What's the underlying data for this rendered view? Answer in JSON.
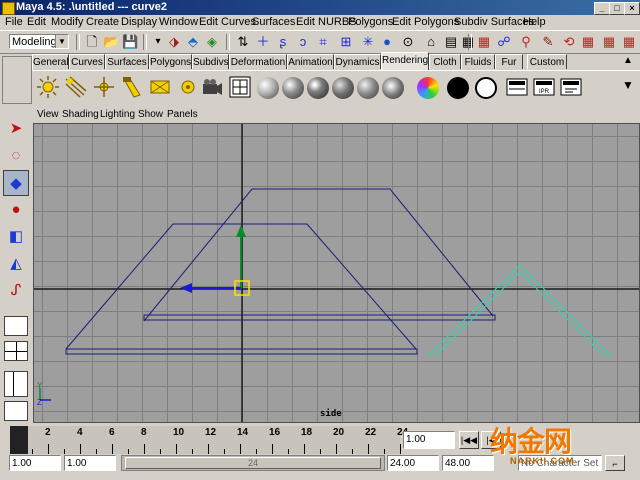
{
  "window": {
    "title": "Maya 4.5: .\\untitled  ---  curve2"
  },
  "menu": [
    "File",
    "Edit",
    "Modify",
    "Create",
    "Display",
    "Window",
    "Edit Curves",
    "Surfaces",
    "Edit NURBS",
    "Polygons",
    "Edit Polygons",
    "Subdiv Surfaces",
    "Help"
  ],
  "statusline": {
    "mode": "Modeling"
  },
  "shelf": {
    "tabs": [
      "General",
      "Curves",
      "Surfaces",
      "Polygons",
      "Subdivs",
      "Deformation",
      "Animation",
      "Dynamics",
      "Rendering",
      "Cloth",
      "Fluids",
      "Fur",
      "Custom"
    ],
    "active_tab": "Rendering",
    "icons": [
      "ambient-light-icon",
      "directional-light-icon",
      "point-light-icon",
      "spot-light-icon",
      "area-light-icon",
      "volume-light-icon",
      "camera-icon",
      "hypershade-icon",
      "lambert-ball-icon",
      "blinn-ball-icon",
      "phong-ball-icon",
      "phonge-ball-icon",
      "anisotropic-ball-icon",
      "ramp-shader-icon",
      "surface-shader-black-icon",
      "use-background-icon",
      "render-icon",
      "ipr-render-icon",
      "render-settings-icon"
    ]
  },
  "panel": {
    "menu": [
      "View",
      "Shading",
      "Lighting",
      "Show",
      "Panels"
    ],
    "view_name": "side",
    "axis_label_y": "Y",
    "axis_label_z": "Z"
  },
  "timeline": {
    "ticks": [
      "2",
      "4",
      "6",
      "8",
      "10",
      "12",
      "14",
      "16",
      "18",
      "20",
      "22",
      "24"
    ],
    "current_time": "1.00",
    "range_start": "1.00",
    "range_start_inner": "1.00",
    "range_knob_label": "24",
    "range_end_inner": "24.00",
    "range_end": "48.00",
    "status": "No Character Set"
  },
  "watermark": {
    "text": "纳金网",
    "url": "NARKII.COM"
  },
  "colors": {
    "titlebar": "#0a246a",
    "viewport_bg": "#9e9e9e",
    "curve_blue": "#1c1c78",
    "curve_cyan": "#2ed6b0",
    "y_axis_green": "#0a8a2a",
    "z_axis_blue": "#1a1ad0",
    "selection_yellow": "#ffe000"
  }
}
